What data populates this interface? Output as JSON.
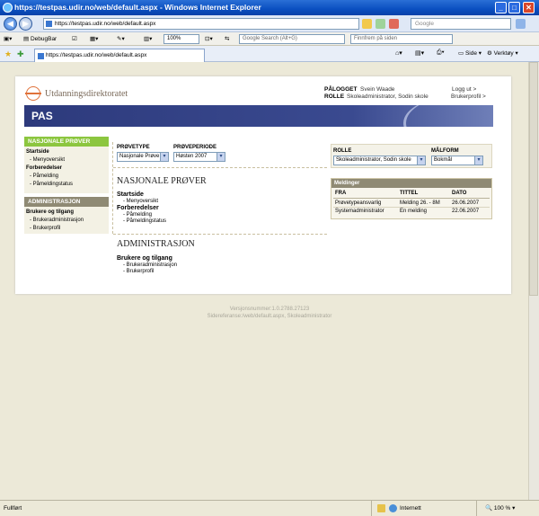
{
  "window": {
    "title": "https://testpas.udir.no/web/default.aspx - Windows Internet Explorer"
  },
  "address": {
    "url": "https://testpas.udir.no/web/default.aspx",
    "search_placeholder": "Google"
  },
  "toolbar": {
    "debugbar": "DebugBar",
    "zoom": "100%",
    "google_search": "Google Search (Alt+G)",
    "find_placeholder": "Finnfrem på siden"
  },
  "tab": {
    "label": "https://testpas.udir.no/web/default.aspx"
  },
  "commandbar": {
    "page": "Side",
    "tools": "Verktøy"
  },
  "header": {
    "logo": "Utdanningsdirektoratet",
    "logged_in_label": "PÅLOGGET",
    "logged_in_value": "Svein Waade",
    "role_label": "ROLLE",
    "role_value": "Skoleadministrator, Sodin skole",
    "logout": "Logg ut >",
    "profile": "Brukerprofil >",
    "banner": "PAS"
  },
  "nav": {
    "np_head": "NASJONALE PRØVER",
    "startside": "Startside",
    "menyoversikt": "Menyoversikt",
    "forberedelser": "Forberedelser",
    "pamelding": "Påmelding",
    "pameldingstatus": "Påmeldingstatus",
    "admin_head": "ADMINISTRASJON",
    "brukere": "Brukere og tilgang",
    "brukeradmin": "Brukeradministrasjon",
    "brukerprofil": "Brukerprofil"
  },
  "filters": {
    "type_label": "PRØVETYPE",
    "type_value": "Nasjonale Prøve",
    "period_label": "PRØVEPERIODE",
    "period_value": "Høsten 2007"
  },
  "main": {
    "np_title": "NASJONALE PRØVER",
    "startside": "Startside",
    "menyoversikt": "Menyoversikt",
    "forberedelser": "Forberedelser",
    "pamelding": "Påmelding",
    "pameldingstatus": "Påmeldingstatus",
    "admin_title": "ADMINISTRASJON",
    "brukere": "Brukere og tilgang",
    "brukeradmin": "Brukeradministrasjon",
    "brukerprofil": "Brukerprofil"
  },
  "rolepanel": {
    "role_label": "ROLLE",
    "role_value": "Skoleadministrator, Sodin skole",
    "lang_label": "MÅLFORM",
    "lang_value": "Bokmål"
  },
  "messages": {
    "title": "Meldinger",
    "headers": [
      "FRA",
      "TITTEL",
      "DATO"
    ],
    "rows": [
      [
        "Prøvetypeansvarlig",
        "Melding 26. - 8M",
        "26.06.2007"
      ],
      [
        "Systemadministrator",
        "En melding",
        "22.06.2007"
      ]
    ]
  },
  "footer": {
    "version": "Versjonsnummer:1.0.2788.27123",
    "reference": "Sidereferanse:/web/default.aspx, Skoleadministrator"
  },
  "status": {
    "left": "Fullført",
    "zone": "Internett",
    "zoom": "100 %"
  }
}
